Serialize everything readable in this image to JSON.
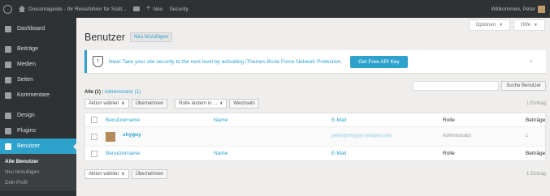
{
  "adminbar": {
    "site_title": "Dressmaguide - Ihr Reiseführer für Südt...",
    "new_label": "Neu",
    "security_label": "Security",
    "greeting": "Willkommen, Peter"
  },
  "sidebar": {
    "items": [
      {
        "label": "Dashboard",
        "icon": "dashboard-icon"
      },
      {
        "label": "Beiträge",
        "icon": "pin-icon"
      },
      {
        "label": "Medien",
        "icon": "media-icon"
      },
      {
        "label": "Seiten",
        "icon": "pages-icon"
      },
      {
        "label": "Kommentare",
        "icon": "comment-icon"
      },
      {
        "label": "Design",
        "icon": "brush-icon"
      },
      {
        "label": "Plugins",
        "icon": "plug-icon"
      },
      {
        "label": "Benutzer",
        "icon": "user-icon"
      }
    ],
    "submenu": [
      "Alle Benutzer",
      "Neu hinzufügen",
      "Dein Profil"
    ]
  },
  "header": {
    "title": "Benutzer",
    "add_new": "Neu hinzufügen",
    "options_tab": "Optionen",
    "help_tab": "Hilfe"
  },
  "notice": {
    "text": "New! Take your site security to the next level by activating iThemes Brute Force Network Protection.",
    "button": "Get Free API Key",
    "close": "×"
  },
  "filters": {
    "all": "Alle",
    "all_count": "(1)",
    "admin": "Administrator",
    "admin_count": "(1)"
  },
  "search": {
    "button": "Suche Benutzer"
  },
  "tablenav_top": {
    "bulk_action": "Aktion wählen",
    "apply": "Übernehmen",
    "role_change": "Rolle ändern in ...",
    "change": "Wechseln",
    "count": "1 Eintrag"
  },
  "table": {
    "headers": {
      "username": "Benutzername",
      "name": "Name",
      "email": "E-Mail",
      "role": "Rolle",
      "posts": "Beiträge"
    },
    "rows": [
      {
        "username": "shyguy",
        "name": "",
        "email": "peter@shyguy-beispiel.com",
        "role": "Administrator",
        "posts": "1"
      }
    ]
  },
  "tablenav_bottom": {
    "bulk_action": "Aktion wählen",
    "apply": "Übernehmen",
    "count": "1 Eintrag"
  },
  "colors": {
    "accent": "#2ea2cc",
    "sidebar_bg": "#2f3234",
    "page_bg": "#efeeec"
  }
}
